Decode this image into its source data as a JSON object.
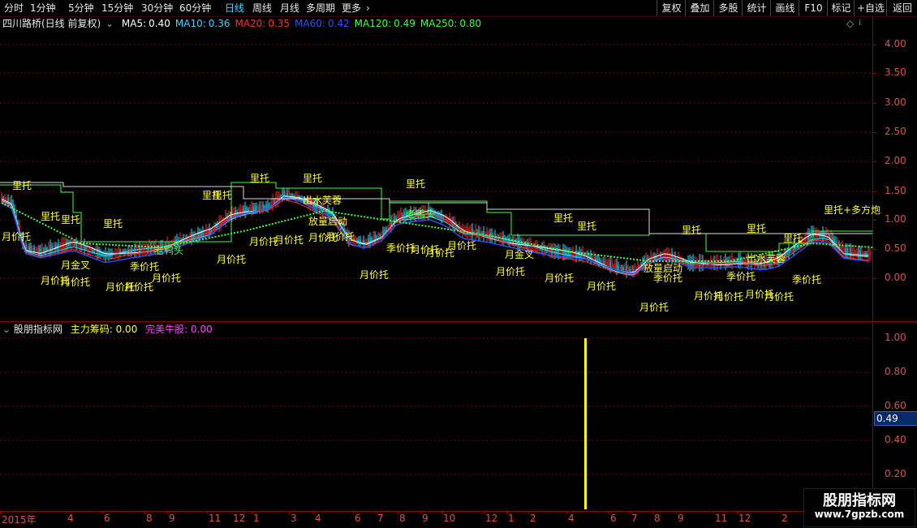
{
  "timeframes": [
    {
      "label": "分时",
      "active": false
    },
    {
      "label": "1分钟",
      "active": false
    },
    {
      "label": "5分钟",
      "active": false
    },
    {
      "label": "15分钟",
      "active": false
    },
    {
      "label": "30分钟",
      "active": false
    },
    {
      "label": "60分钟",
      "active": false
    },
    {
      "label": "日线",
      "active": true
    },
    {
      "label": "周线",
      "active": false
    },
    {
      "label": "月线",
      "active": false
    },
    {
      "label": "多周期",
      "active": false
    },
    {
      "label": "更多",
      "active": false
    }
  ],
  "right_buttons": [
    "复权",
    "叠加",
    "多股",
    "统计",
    "画线",
    "F10",
    "标记",
    "+自选",
    "返回"
  ],
  "main_chart": {
    "stock_title": "四川路桥(日线 前复权)",
    "ma": [
      {
        "label": "MA5:",
        "value": "0.40",
        "color": "#ffffff"
      },
      {
        "label": "MA10:",
        "value": "0.36",
        "color": "#4fd0ff"
      },
      {
        "label": "MA20:",
        "value": "0.35",
        "color": "#ff3030"
      },
      {
        "label": "MA60:",
        "value": "0.42",
        "color": "#3050ff"
      },
      {
        "label": "MA120:",
        "value": "0.49",
        "color": "#40ff40"
      },
      {
        "label": "MA250:",
        "value": "0.80",
        "color": "#40ff40"
      }
    ],
    "diamond_icon": "◇",
    "yticks": [
      "4.00",
      "3.50",
      "3.00",
      "2.50",
      "2.00",
      "1.50",
      "1.00",
      "0.50",
      "0.00"
    ]
  },
  "indicator": {
    "title": "股朋指标网",
    "line1_label": "主力筹码:",
    "line1_value": "0.00",
    "line2_label": "完美牛股:",
    "line2_value": "0.00",
    "yticks": [
      "1.00",
      "0.80",
      "0.60",
      "0.40",
      "0.20"
    ],
    "last_value": "0.49"
  },
  "date_axis": [
    "2015年",
    "4",
    "6",
    "8",
    "9",
    "11",
    "12",
    "1",
    "3",
    "4",
    "6",
    "7",
    "8",
    "9",
    "10",
    "12",
    "1",
    "2",
    "4",
    "6",
    "7",
    "8",
    "9",
    "11",
    "12",
    "2"
  ],
  "signals": [
    {
      "t": "里托",
      "c": "y"
    },
    {
      "t": "月价托",
      "c": "y"
    },
    {
      "t": "里托",
      "c": "y"
    },
    {
      "t": "里托",
      "c": "y"
    },
    {
      "t": "月金叉",
      "c": "y"
    },
    {
      "t": "月价托",
      "c": "y"
    },
    {
      "t": "月价托",
      "c": "y"
    },
    {
      "t": "里托",
      "c": "y"
    },
    {
      "t": "月价托",
      "c": "y"
    },
    {
      "t": "月价托",
      "c": "y"
    },
    {
      "t": "季价托",
      "c": "y"
    },
    {
      "t": "月价托",
      "c": "y"
    },
    {
      "t": "老鸭头",
      "c": "g"
    },
    {
      "t": "月价托",
      "c": "y"
    },
    {
      "t": "里托",
      "c": "y"
    },
    {
      "t": "里托",
      "c": "y"
    },
    {
      "t": "月价托",
      "c": "y"
    },
    {
      "t": "月价托",
      "c": "y"
    },
    {
      "t": "里托",
      "c": "y"
    },
    {
      "t": "出水芙蓉",
      "c": "y"
    },
    {
      "t": "放量启动",
      "c": "y"
    },
    {
      "t": "月价托",
      "c": "y"
    },
    {
      "t": "月价托",
      "c": "y"
    },
    {
      "t": "里托",
      "c": "y"
    },
    {
      "t": "老鸭头",
      "c": "g"
    },
    {
      "t": "里托",
      "c": "y"
    },
    {
      "t": "季价托",
      "c": "y"
    },
    {
      "t": "月价托",
      "c": "y"
    },
    {
      "t": "月价托",
      "c": "y"
    },
    {
      "t": "月价托",
      "c": "y"
    },
    {
      "t": "月价托",
      "c": "y"
    },
    {
      "t": "月金叉",
      "c": "y"
    },
    {
      "t": "月价托",
      "c": "y"
    },
    {
      "t": "里托",
      "c": "y"
    },
    {
      "t": "里托",
      "c": "y"
    },
    {
      "t": "月价托",
      "c": "y"
    },
    {
      "t": "月价托",
      "c": "y"
    },
    {
      "t": "里托",
      "c": "y"
    },
    {
      "t": "放量启动",
      "c": "y"
    },
    {
      "t": "季价托",
      "c": "y"
    },
    {
      "t": "月价托",
      "c": "y"
    },
    {
      "t": "月价托",
      "c": "y"
    },
    {
      "t": "里托",
      "c": "y"
    },
    {
      "t": "季价托",
      "c": "y"
    },
    {
      "t": "出水芙蓉",
      "c": "y"
    },
    {
      "t": "月价托",
      "c": "y"
    },
    {
      "t": "月价托",
      "c": "y"
    },
    {
      "t": "里托",
      "c": "y"
    },
    {
      "t": "季价托",
      "c": "y"
    },
    {
      "t": "里托+多方炮",
      "c": "y"
    },
    {
      "t": "月价托",
      "c": "y"
    }
  ],
  "watermark": {
    "line1": "股朋指标网",
    "line2": "www.7gpzb.com"
  }
}
